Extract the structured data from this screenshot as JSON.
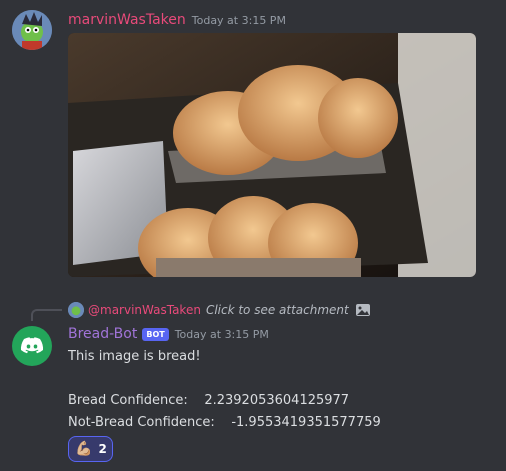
{
  "message1": {
    "author": "marvinWasTaken",
    "timestamp": "Today at 3:15 PM",
    "author_color": "#e84a7a",
    "attachment": "image"
  },
  "reply": {
    "mention": "@marvinWasTaken",
    "hint": "Click to see attachment",
    "icon": "image-icon"
  },
  "message2": {
    "author": "Bread-Bot",
    "tag": "BOT",
    "timestamp": "Today at 3:15 PM",
    "author_color": "#a074d8",
    "lines": [
      "This image is bread!",
      "Bread Confidence:    2.2392053604125977",
      "Not-Bread Confidence:    -1.9553419351577759"
    ],
    "reaction": {
      "emoji": "💪🏼",
      "count": "2"
    }
  }
}
